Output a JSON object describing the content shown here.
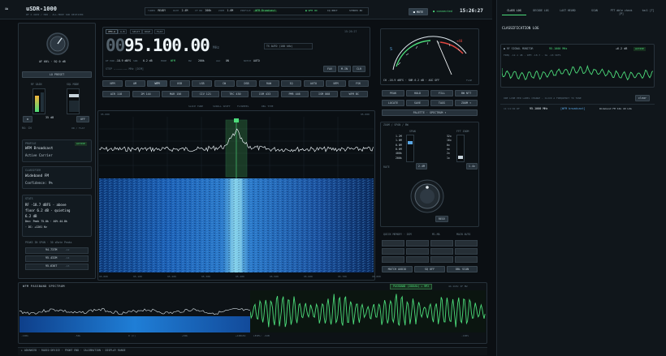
{
  "app": {
    "title": "uSDR-1000",
    "subtitle": "RF 2.4GHZ / HDR · ALL-MODE SDR RECEIVER"
  },
  "header": {
    "items": [
      {
        "label": "TUNER",
        "value": "READY"
      },
      {
        "label": "RATE",
        "value": "2.4M"
      },
      {
        "label": "IF BW",
        "value": "200k"
      },
      {
        "label": "ZOOM",
        "value": "1.0M"
      },
      {
        "label": "PROFILE",
        "value": "WFM Broadcast"
      }
    ],
    "chips": [
      "● WFM ON",
      "IQ 8BIT",
      "STEREO 8K"
    ],
    "mute_label": "■ MUTE",
    "connected_label": "● connected",
    "clock": "15:26:27"
  },
  "right_tabs": [
    {
      "label": "CLASS LOG"
    },
    {
      "label": "DECODE LOG"
    },
    {
      "label": "LAST HEARD"
    },
    {
      "label": "SCAN"
    },
    {
      "label": "PTT dble check [P]"
    },
    {
      "label": "tail [T]"
    }
  ],
  "left": {
    "af_gain_label": "AF 60%  ·  SQ 0 dB",
    "lo_preset": "LO PRESET",
    "rf_gain_label": "RF GAIN",
    "sql_label": "SQL MODE",
    "rf_value": "35 dB",
    "sql_value": "OFF",
    "rx_ch": "RX: CH",
    "rx_ch_value": "ON / FLAT",
    "profile_title": "PROFILE",
    "profile_value": "WFM Broadcast",
    "profile_active": "ACTIVE",
    "profile_sub": "Active Carrier",
    "class_title": "CLASSIFIER",
    "class_value": "Wideband FM",
    "class_conf": "Confidence: 9%",
    "stats_title": "STATS",
    "stats_lines": [
      "RF -18.7 dBFS · above",
      "floor 6.2 dB · quieting",
      "6.2 dB",
      "Dev: Peak 75.0k · 40% 44.8k",
      "· DC: +1201 Hz"
    ],
    "peaks_title": "PEAKS IN SPAN · 30 sRate Peaks",
    "peaks": [
      {
        "freq": "94.737M",
        "val": "-12"
      },
      {
        "freq": "95.432M",
        "val": "-14"
      },
      {
        "freq": "95.636T",
        "val": "-15"
      }
    ]
  },
  "tuner": {
    "tabs": [
      "VFO-A",
      "A·B",
      "SPLIT",
      "ROLE",
      "FLAT"
    ],
    "time": "15:26:27",
    "freq_dim": "00",
    "freq_main": "95.100.00",
    "freq_unit": "MHz",
    "meta": [
      {
        "label": "RF PWR",
        "value": "-18.9 dBFS"
      },
      {
        "label": "SNR",
        "value": "6.2 dB"
      },
      {
        "label": "MODE",
        "value": "WFM"
      },
      {
        "label": "BW",
        "value": "200k"
      },
      {
        "label": "AGC",
        "value": "ON"
      },
      {
        "label": "NOTCH",
        "value": "AUTO"
      }
    ],
    "ts_label": "TS  AUTO (100 kHz)",
    "step_text": "STEP  —.———.——  MHz   [DIM]",
    "step_btns": [
      "FAV",
      "M-IN",
      "CLR"
    ],
    "mode_btns": [
      "NFM",
      "AM",
      "WFM",
      "USB",
      "LSB",
      "CW",
      "DSB",
      "RAW",
      "IQ",
      "AUTO",
      "NFM",
      "FSK"
    ],
    "mode_btns2": [
      "AIR 118",
      "2M 144",
      "MAR 156",
      "CIV 121",
      "TRC 430",
      "ISM 433",
      "PMR 446",
      "ISM 868",
      "WFM BC"
    ]
  },
  "meter": {
    "readout": "CH -18.9 dBFS · SNR 6.2 dB · AGC OFF",
    "flap": "FLAP",
    "btns_row1": [
      "PEAK",
      "HOLD",
      "FILL",
      "BW NTT"
    ],
    "btns_row2": [
      "LOCATE",
      "SAVE",
      "TAGS",
      "ZOOM ▾"
    ],
    "palette": "PALETTE · SPECTRUM ▾"
  },
  "spectrum": {
    "hdr_left": "95.000",
    "hdr_mid": [
      "SLICE TUNE",
      "SCROLL SHIFT",
      "FLYWHEEL",
      "DBL TYPE"
    ],
    "hdr_right": "95.000",
    "ticks": [
      "95.000",
      "95.100",
      "95.200",
      "95.300",
      "95.400",
      "95.500",
      "95.600",
      "95.700",
      "95.800"
    ]
  },
  "zoom": {
    "title": "ZOOM / SPAN / BW",
    "labels": [
      "SPAN",
      "FFT ZOOM"
    ],
    "span_items": [
      "1.2M",
      "1.0M",
      "0.8M",
      "0.6M",
      "400k",
      "200k"
    ],
    "fft_items": [
      "32x",
      "16x",
      "8x",
      "4x",
      "2x",
      "1x"
    ],
    "span_value": "2.4M",
    "fft_value": "1.4x",
    "rate_lbl": "RATE",
    "resv_lbl": "RESV"
  },
  "quick": {
    "title": "QUICK MEMORY · DIM",
    "sub1": "M1-MA",
    "sub2": "MAIN AUTO",
    "btns": [
      "MATCH AUDIO",
      "SQ OFF",
      "DBL SCAN"
    ]
  },
  "audio": {
    "title": "WFM PASSBAND SPECTRUM",
    "badge": "PASSBAND (200kHz) ▸ MPX",
    "rate": "44.1kHz  IF BW",
    "ticks_left": [
      "-100k",
      "-50k",
      "0 (C)",
      "+50k",
      "+100kHz"
    ],
    "ticks_right": [
      "LEVEL: -6dB",
      "",
      "",
      "",
      "",
      "",
      "-100%"
    ]
  },
  "footer": "▸ ADVANCED · RADIO DEVICE · FRONT END · CALIBRATION · DISPLAY RANGE",
  "classlog": {
    "title": "CLASSIFICATION LOG",
    "entry_line1": "● RF SIGNAL MONITOR",
    "entry_freq": "95.1000 MHz",
    "entry_snr": "+6.2 dB",
    "entry_badge": "ACTIVE",
    "entry_line2": "FREQ -12.1 dB  · WFM -18.7  · SG -18 VDFS",
    "log_hint": "ONE LINE PER LABEL CHANGE · CLICK A FREQUENCY TO TUNE",
    "clear": "clear",
    "log_time": "11:11:02 RF",
    "log_freq": "95.1000 MHz",
    "log_badge": "[WFM broadcast]",
    "log_tail": "Wideband FM  SIG 40 LOG"
  }
}
